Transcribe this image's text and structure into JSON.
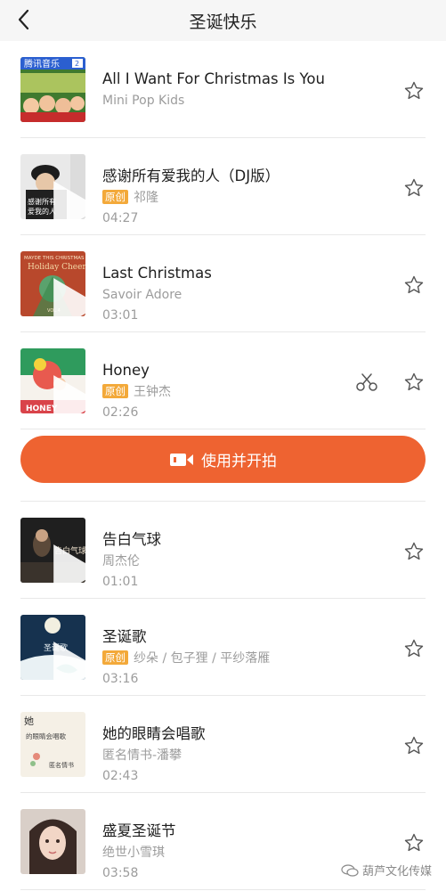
{
  "header": {
    "title": "圣诞快乐"
  },
  "songs_top": [
    {
      "title": "All I Want For Christmas Is You",
      "artist": "Mini Pop Kids",
      "original": "",
      "duration": ""
    },
    {
      "title": "感谢所有爱我的人（DJ版）",
      "artist": "祁隆",
      "original": "原创",
      "duration": "04:27"
    },
    {
      "title": "Last Christmas",
      "artist": "Savoir Adore",
      "original": "",
      "duration": "03:01"
    },
    {
      "title": "Honey",
      "artist": "王钟杰",
      "original": "原创",
      "duration": "02:26"
    }
  ],
  "use_button": {
    "label": "使用并开拍"
  },
  "songs_bottom": [
    {
      "title": "告白气球",
      "artist": "周杰伦",
      "original": "",
      "duration": "01:01"
    },
    {
      "title": "圣诞歌",
      "artist": "纱朵 / 包子狸 / 平纱落雁",
      "original": "原创",
      "duration": "03:16"
    },
    {
      "title": "她的眼睛会唱歌",
      "artist": "匿名情书-潘攀",
      "original": "",
      "duration": "02:43"
    },
    {
      "title": "盛夏圣诞节",
      "artist": "绝世小雪琪",
      "original": "",
      "duration": "03:58"
    }
  ],
  "covers": {
    "c1": {
      "top": "腾讯音乐",
      "tag": "2"
    },
    "c2": {
      "line1": "感谢所有",
      "line2": "爱我的人"
    },
    "c3": {
      "top": "MAYDE  THIS CHRISTMAS",
      "mid": "Holiday Cheer",
      "bot": "VOL.4"
    },
    "c4": {
      "bot": "HONEY"
    },
    "c5": {
      "mid": "告白气球"
    },
    "c6": {
      "mid": "圣诞歌"
    },
    "c7": {
      "l1": "她",
      "l2": "的眼睛会唱歌",
      "l3": "匿名情书"
    }
  },
  "watermark": {
    "text": "葫芦文化传媒"
  },
  "colors": {
    "accent": "#ee6331",
    "badge": "#f3a93a",
    "muted": "#9c9c9c"
  }
}
